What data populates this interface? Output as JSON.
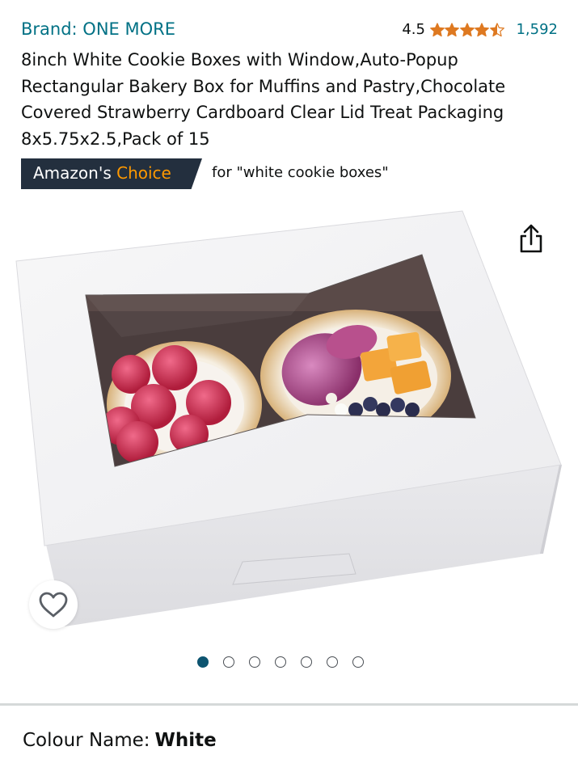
{
  "brand": {
    "label": "Brand: ONE MORE"
  },
  "rating": {
    "value": "4.5",
    "stars": 4.5,
    "review_count": "1,592",
    "star_color": "#de7921"
  },
  "product": {
    "title": "8inch White Cookie Boxes with Window,Auto-Popup Rectangular Bakery Box for Muffins and Pastry,Chocolate Covered Strawberry Cardboard Clear Lid Treat Packaging 8x5.75x2.5,Pack of 15"
  },
  "badge": {
    "prefix": "Amazon's ",
    "accent": "Choice",
    "query": "for \"white cookie boxes\"",
    "bg_color": "#232f3e",
    "accent_color": "#ff9900"
  },
  "gallery": {
    "image_count": 7,
    "current_index": 1,
    "share_icon": "share-icon",
    "favorite_icon": "heart-outline-icon"
  },
  "variation": {
    "label": "Colour Name:",
    "value": "White"
  },
  "colors": {
    "link": "#007185",
    "text": "#0f1111",
    "active_dot": "#0d5470"
  }
}
